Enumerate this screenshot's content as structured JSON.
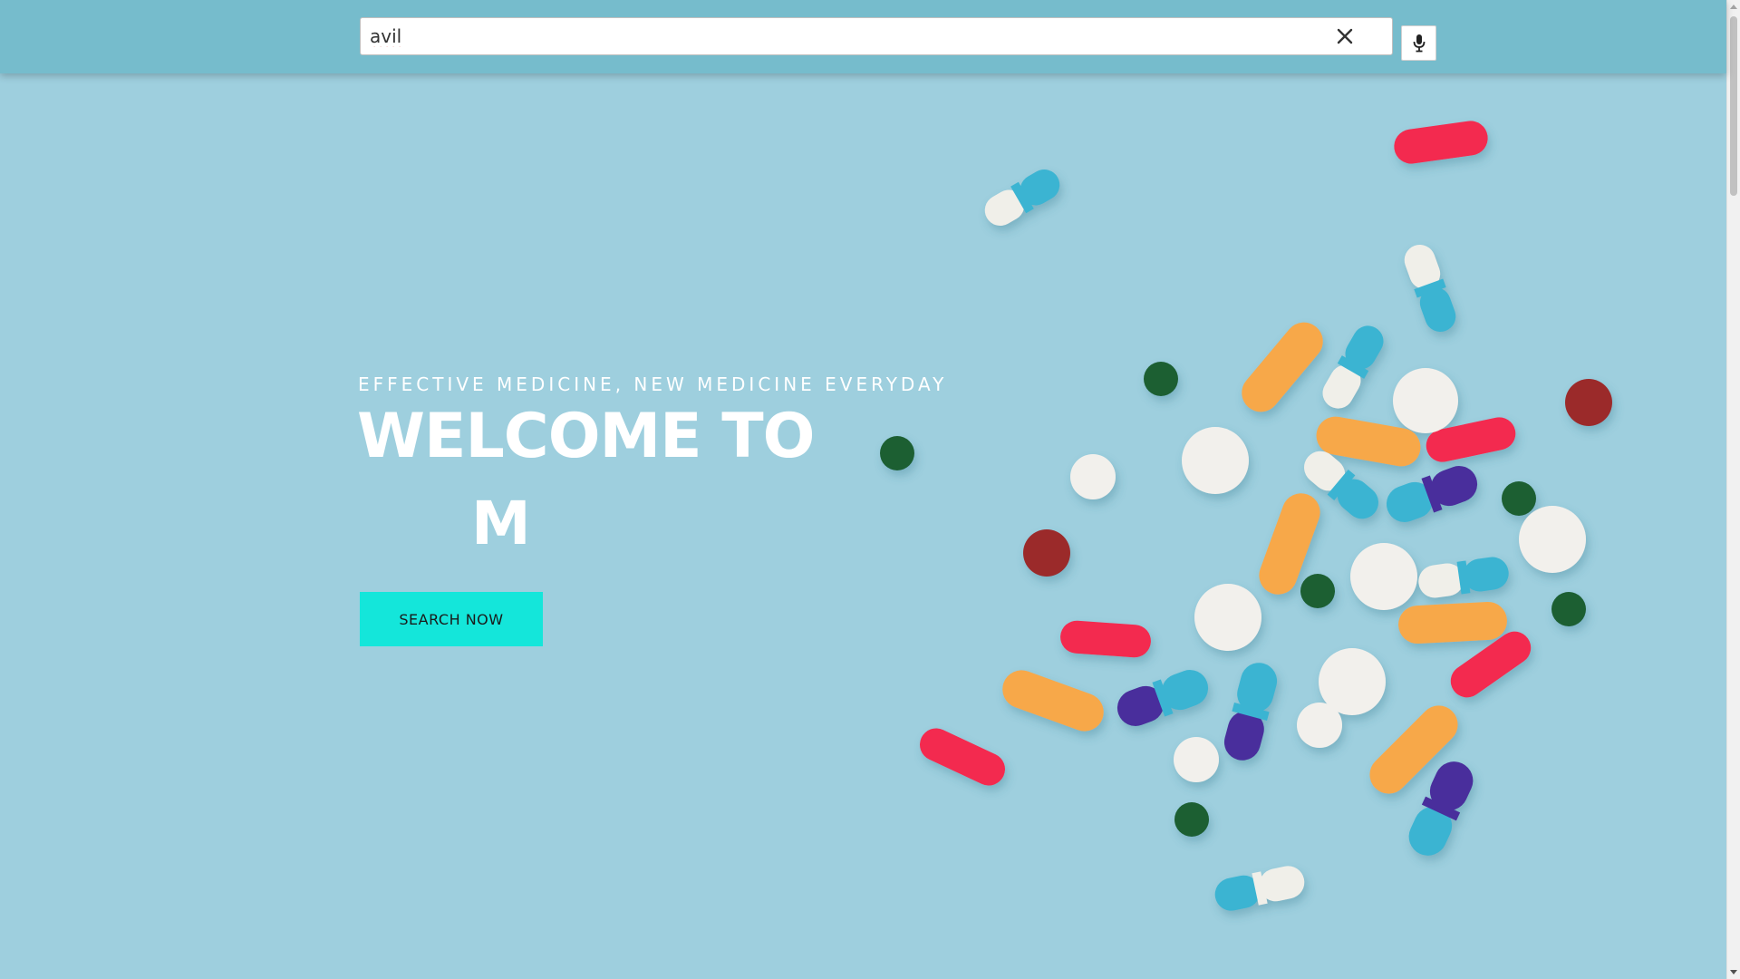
{
  "search": {
    "value": "avil"
  },
  "hero": {
    "tagline": "EFFECTIVE MEDICINE, NEW MEDICINE EVERYDAY",
    "headline": "WELCOME TO",
    "brand": "M",
    "cta_label": "SEARCH NOW"
  },
  "icons": {
    "clear": "close-icon",
    "mic": "microphone-icon"
  },
  "colors": {
    "background": "#9ecfde",
    "header": "#76bccc",
    "cta": "#14e6da",
    "text": "#ffffff"
  }
}
